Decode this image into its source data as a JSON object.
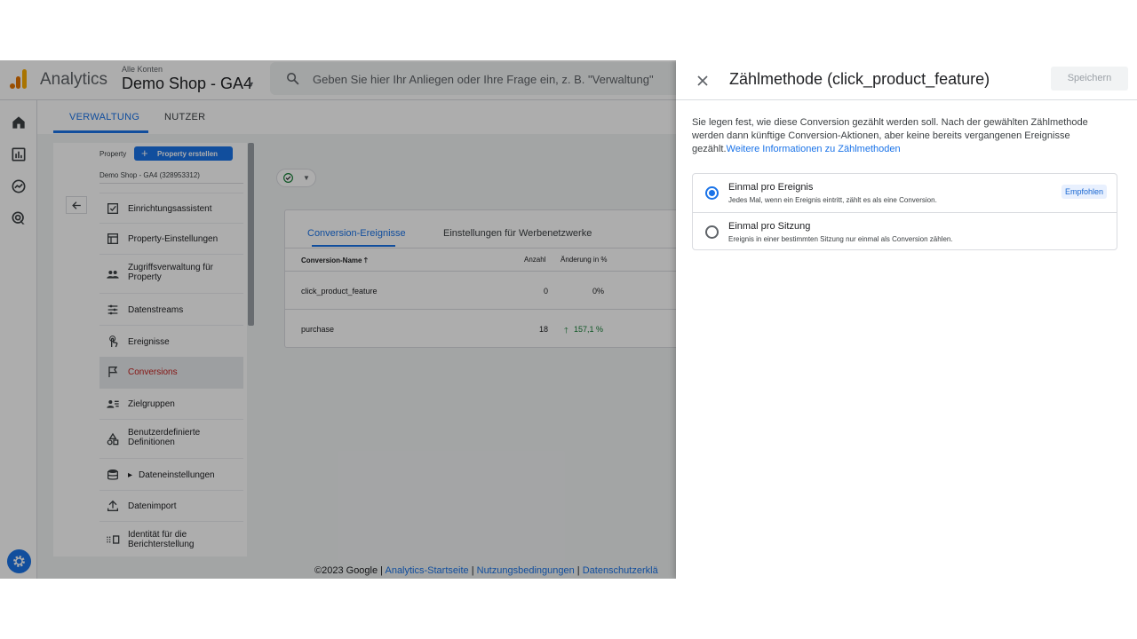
{
  "header": {
    "app_name": "Analytics",
    "account_small": "Alle Konten",
    "account_name": "Demo Shop - GA4",
    "search_placeholder": "Geben Sie hier Ihr Anliegen oder Ihre Frage ein, z. B. \"Verwaltung\""
  },
  "rail": {
    "icons": [
      "home-icon",
      "reports-icon",
      "explore-icon",
      "advertising-icon"
    ],
    "settings_icon": "gear-icon"
  },
  "tabs": {
    "verwaltung": "VERWALTUNG",
    "nutzer": "NUTZER"
  },
  "admin": {
    "property_label": "Property",
    "create_button": "Property erstellen",
    "property_id": "Demo Shop - GA4 (328953312)",
    "items": [
      {
        "label": "Einrichtungsassistent",
        "icon": "checklist-icon"
      },
      {
        "label": "Property-Einstellungen",
        "icon": "settings-page-icon"
      },
      {
        "label": "Zugriffsverwaltung für Property",
        "icon": "people-icon"
      },
      {
        "label": "Datenstreams",
        "icon": "streams-icon"
      },
      {
        "label": "Ereignisse",
        "icon": "touch-icon"
      },
      {
        "label": "Conversions",
        "icon": "flag-icon"
      },
      {
        "label": "Zielgruppen",
        "icon": "audience-icon"
      },
      {
        "label": "Benutzerdefinierte Definitionen",
        "icon": "shapes-icon"
      },
      {
        "label": "Dateneinstellungen",
        "icon": "database-icon"
      },
      {
        "label": "Datenimport",
        "icon": "upload-icon"
      },
      {
        "label": "Identität für die Berichterstellung",
        "icon": "identity-icon"
      }
    ]
  },
  "conversions": {
    "tab_events": "Conversion-Ereignisse",
    "tab_network": "Einstellungen für Werbenetzwerke",
    "columns": {
      "name": "Conversion-Name",
      "count": "Anzahl",
      "change": "Änderung in %"
    },
    "rows": [
      {
        "name": "click_product_feature",
        "count": "0",
        "change": "0%"
      },
      {
        "name": "purchase",
        "count": "18",
        "change": "157,1 %"
      }
    ]
  },
  "footer": {
    "copyright": "©2023 Google",
    "sep": " | ",
    "link1": "Analytics-Startseite",
    "link2": "Nutzungsbedingungen",
    "link3": "Datenschutzerklä"
  },
  "panel": {
    "title": "Zählmethode (click_product_feature)",
    "save": "Speichern",
    "description": "Sie legen fest, wie diese Conversion gezählt werden soll. Nach der gewählten Zählmethode werden dann künftige Conversion-Aktionen, aber keine bereits vergangenen Ereignisse gezählt.",
    "more_link": "Weitere Informationen zu Zählmethoden",
    "options": [
      {
        "title": "Einmal pro Ereignis",
        "subtitle": "Jedes Mal, wenn ein Ereignis eintritt, zählt es als eine Conversion.",
        "badge": "Empfohlen",
        "selected": true
      },
      {
        "title": "Einmal pro Sitzung",
        "subtitle": "Ereignis in einer bestimmten Sitzung nur einmal als Conversion zählen.",
        "selected": false
      }
    ]
  },
  "colors": {
    "accent": "#1a73e8",
    "active_nav": "#c5221f",
    "positive": "#188038"
  }
}
